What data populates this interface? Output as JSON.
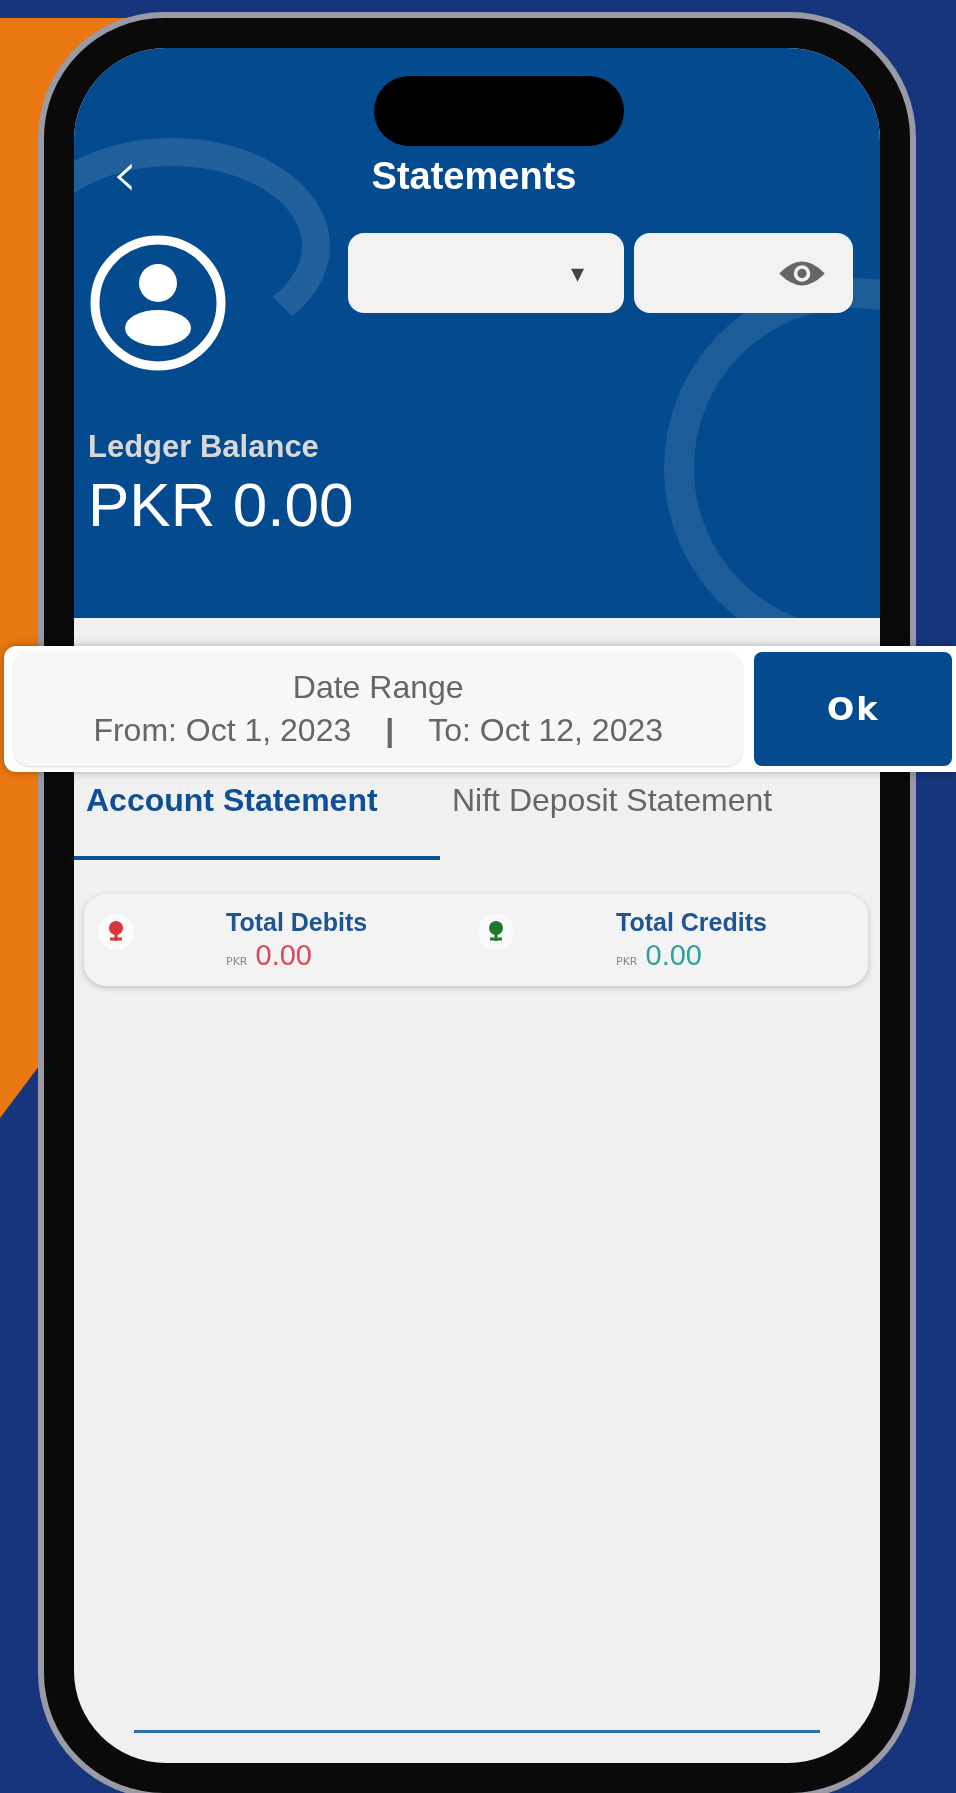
{
  "header": {
    "back": "‹",
    "title": "Statements",
    "account_dropdown": {
      "caret": "▾"
    },
    "ledger_label": "Ledger Balance",
    "ledger_amount": "PKR 0.00"
  },
  "date_range": {
    "title": "Date Range",
    "from": "From: Oct 1, 2023",
    "separator": "|",
    "to": "To: Oct 12, 2023",
    "ok": "Ok"
  },
  "tabs": [
    {
      "label": "Account Statement",
      "selected": true
    },
    {
      "label": "Nift Deposit Statement",
      "selected": false
    }
  ],
  "totals": [
    {
      "kind": "debit",
      "label": "Total Debits",
      "currency": "PKR",
      "amount": "0.00"
    },
    {
      "kind": "credit",
      "label": "Total Credits",
      "currency": "PKR",
      "amount": "0.00"
    }
  ]
}
